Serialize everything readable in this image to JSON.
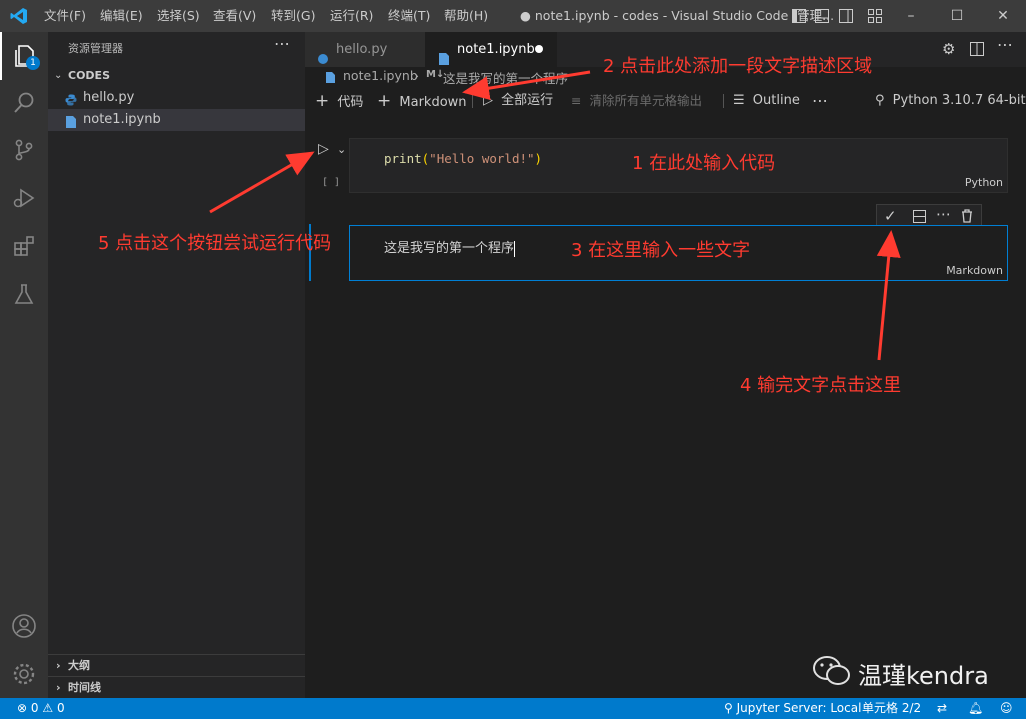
{
  "titlebar": {
    "menus": [
      "文件(F)",
      "编辑(E)",
      "选择(S)",
      "查看(V)",
      "转到(G)",
      "运行(R)",
      "终端(T)",
      "帮助(H)"
    ],
    "title": "● note1.ipynb - codes - Visual Studio Code [管理..."
  },
  "activity": {
    "badge": "1"
  },
  "sidebar": {
    "header": "资源管理器",
    "folder": "CODES",
    "files": [
      "hello.py",
      "note1.ipynb"
    ],
    "outline": "大纲",
    "timeline": "时间线"
  },
  "tabs": {
    "items": [
      "hello.py",
      "note1.ipynb"
    ]
  },
  "breadcrumb": {
    "file": "note1.ipynb",
    "md_prefix": "M↓",
    "section": "这是我写的第一个程序"
  },
  "toolbar": {
    "add_code": "代码",
    "add_markdown": "Markdown",
    "run_all": "全部运行",
    "clear_outputs": "清除所有单元格输出",
    "outline": "Outline",
    "kernel": "Python 3.10.7 64-bit"
  },
  "code_cell": {
    "fn": "print",
    "open": "(",
    "string": "\"Hello world!\"",
    "close": ")",
    "exec_count": "[ ]",
    "lang": "Python"
  },
  "md_cell": {
    "text": "这是我写的第一个程序",
    "lang": "Markdown"
  },
  "annotations": {
    "a1": "1 在此处输入代码",
    "a2": "2 点击此处添加一段文字描述区域",
    "a3": "3 在这里输入一些文字",
    "a4": "4 输完文字点击这里",
    "a5": "5 点击这个按钮尝试运行代码"
  },
  "status": {
    "errors": "0",
    "warnings": "0",
    "jupyter": "Jupyter Server: Local",
    "cell": "单元格 2/2"
  },
  "watermark": {
    "text": "温瑾kendra"
  },
  "colors": {
    "accent": "#007acc",
    "annotation": "#ff3b30",
    "string": "#ce9178",
    "function": "#dcdcaa"
  }
}
